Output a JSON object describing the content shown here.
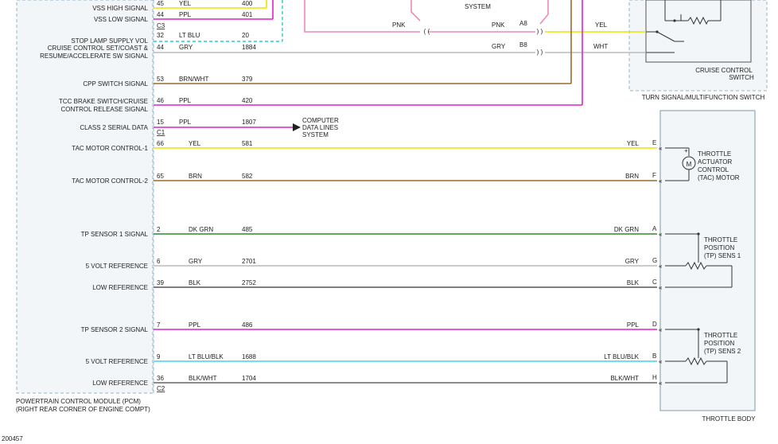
{
  "diagram": {
    "figure_id": "200457",
    "pcm": {
      "title_line1": "POWERTRAIN CONTROL MODULE (PCM)",
      "title_line2": "(RIGHT REAR CORNER OF ENGINE COMPT)",
      "connectors": {
        "c1": "C1",
        "c2": "C2",
        "c3": "C3"
      }
    },
    "throttle_body": {
      "title": "THROTTLE BODY",
      "tac_motor": {
        "line1": "THROTTLE",
        "line2": "ACTUATOR",
        "line3": "CONTROL",
        "line4": "(TAC) MOTOR",
        "symbol": "M"
      },
      "tps1": {
        "line1": "THROTTLE",
        "line2": "POSITION",
        "line3": "(TP) SENS 1"
      },
      "tps2": {
        "line1": "THROTTLE",
        "line2": "POSITION",
        "line3": "(TP) SENS 2"
      }
    },
    "cruise_switch": {
      "line1": "CRUISE CONTROL",
      "line2": "SWITCH",
      "assembly": "TURN SIGNAL/MULTIFUNCTION SWITCH"
    },
    "top": {
      "system_text": "SYSTEM",
      "pnk_left": "PNK",
      "pnk_right": "PNK",
      "gry_right": "GRY",
      "a8": "A8",
      "b8": "B8",
      "yel": "YEL",
      "wht": "WHT"
    },
    "computer_lines": {
      "line1": "COMPUTER",
      "line2": "DATA LINES",
      "line3": "SYSTEM"
    },
    "circuits": [
      {
        "label": "VSS HIGH SIGNAL",
        "pin": "45",
        "color": "YEL",
        "circuit": "400",
        "hex": "#e8e600"
      },
      {
        "label": "VSS LOW SIGNAL",
        "pin": "44",
        "color": "PPL",
        "circuit": "401",
        "hex": "#e020d0"
      },
      {
        "label": "STOP LAMP SUPPLY VOL",
        "pin": "32",
        "color": "LT BLU",
        "circuit": "20",
        "hex": "#22ccdd"
      },
      {
        "label": "CRUISE CONTROL SET/COAST &",
        "label2": "RESUME/ACCELERATE SW SIGNAL",
        "pin": "44",
        "color": "GRY",
        "circuit": "1884",
        "hex": "#bbbbbb"
      },
      {
        "label": "CPP SWITCH SIGNAL",
        "pin": "53",
        "color": "BRN/WHT",
        "circuit": "379",
        "hex": "#9a6b2f"
      },
      {
        "label": "TCC BRAKE SWITCH/CRUISE",
        "label2": "CONTROL RELEASE SIGNAL",
        "pin": "46",
        "color": "PPL",
        "circuit": "420",
        "hex": "#e020d0"
      },
      {
        "label": "CLASS 2 SERIAL DATA",
        "pin": "15",
        "color": "PPL",
        "circuit": "1807",
        "hex": "#e020d0"
      },
      {
        "label": "TAC MOTOR CONTROL-1",
        "pin": "66",
        "color": "YEL",
        "circuit": "581",
        "tb_pin": "E",
        "tb_color": "YEL",
        "hex": "#e8e600"
      },
      {
        "label": "TAC MOTOR CONTROL-2",
        "pin": "65",
        "color": "BRN",
        "circuit": "582",
        "tb_pin": "F",
        "tb_color": "BRN",
        "hex": "#9a6b2f"
      },
      {
        "label": "TP SENSOR 1 SIGNAL",
        "pin": "2",
        "color": "DK GRN",
        "circuit": "485",
        "tb_pin": "A",
        "tb_color": "DK GRN",
        "hex": "#2f8a2f"
      },
      {
        "label": "5 VOLT REFERENCE",
        "pin": "6",
        "color": "GRY",
        "circuit": "2701",
        "tb_pin": "G",
        "tb_color": "GRY",
        "hex": "#bbbbbb"
      },
      {
        "label": "LOW REFERENCE",
        "pin": "39",
        "color": "BLK",
        "circuit": "2752",
        "tb_pin": "C",
        "tb_color": "BLK",
        "hex": "#555555"
      },
      {
        "label": "TP SENSOR 2 SIGNAL",
        "pin": "7",
        "color": "PPL",
        "circuit": "486",
        "tb_pin": "D",
        "tb_color": "PPL",
        "hex": "#e020d0"
      },
      {
        "label": "5 VOLT REFERENCE",
        "pin": "9",
        "color": "LT BLU/BLK",
        "circuit": "1688",
        "tb_pin": "B",
        "tb_color": "LT BLU/BLK",
        "hex": "#44d4e4"
      },
      {
        "label": "LOW REFERENCE",
        "pin": "36",
        "color": "BLK/WHT",
        "circuit": "1704",
        "tb_pin": "H",
        "tb_color": "BLK/WHT",
        "hex": "#666666"
      }
    ]
  }
}
